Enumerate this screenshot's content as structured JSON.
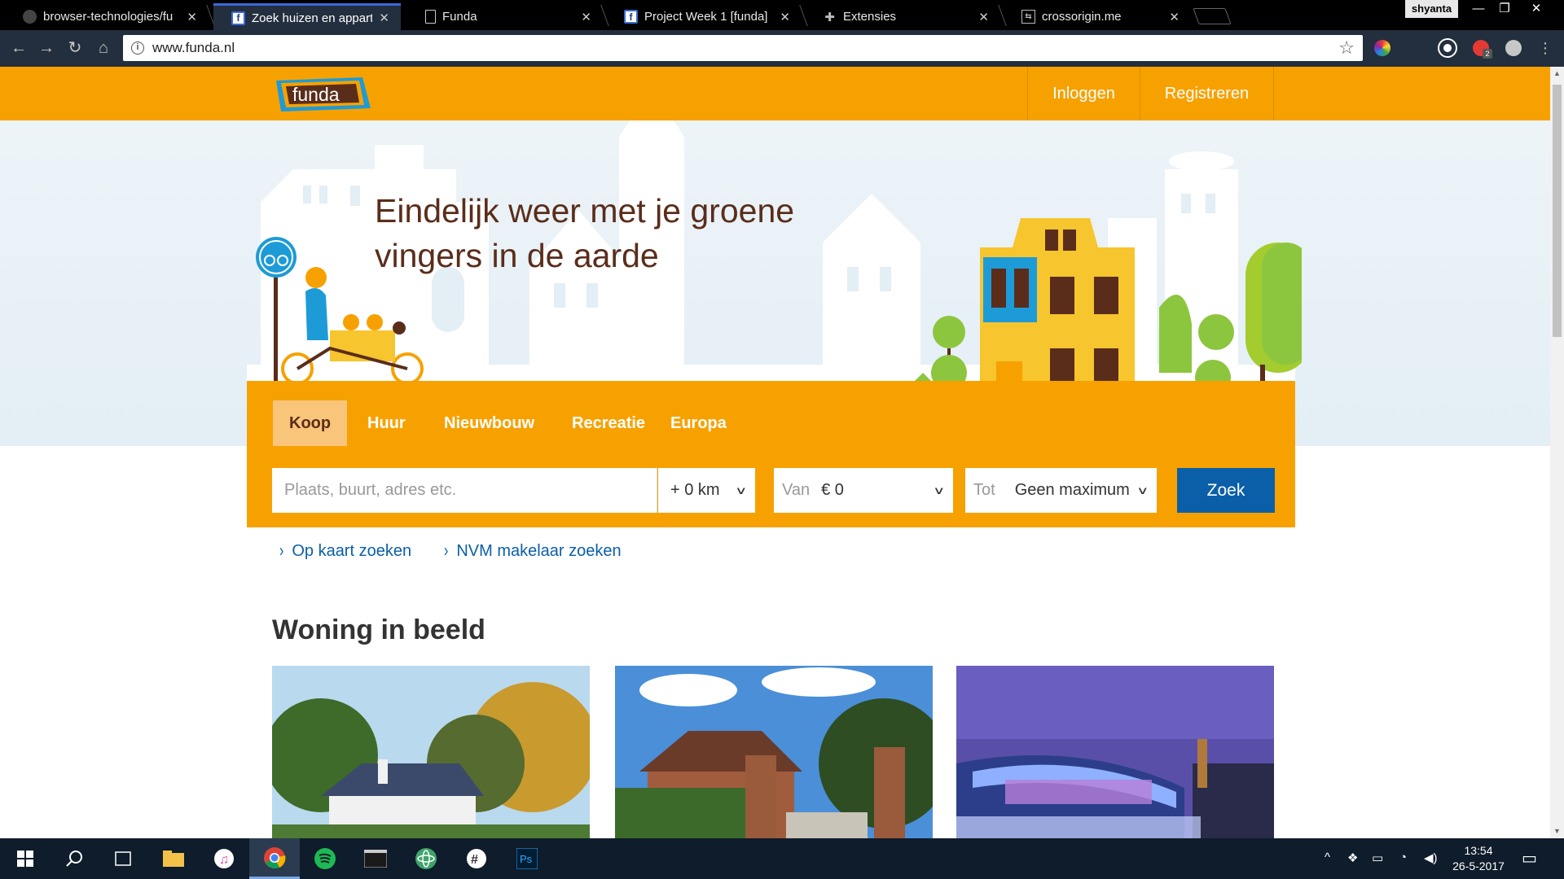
{
  "browser": {
    "tabs": [
      {
        "label": "browser-technologies/fu",
        "favicon": "github-icon",
        "active": false
      },
      {
        "label": "Zoek huizen en apparten",
        "favicon": "funda-icon",
        "active": true
      },
      {
        "label": "Funda",
        "favicon": "document-icon",
        "active": false
      },
      {
        "label": "Project Week 1 [funda]",
        "favicon": "funda-icon",
        "active": false
      },
      {
        "label": "Extensies",
        "favicon": "puzzle-icon",
        "active": false
      },
      {
        "label": "crossorigin.me",
        "favicon": "arrows-icon",
        "active": false
      }
    ],
    "profile_name": "shyanta",
    "url": "www.funda.nl",
    "extension_badge": "2"
  },
  "header": {
    "logo_text": "funda",
    "login_label": "Inloggen",
    "register_label": "Registreren"
  },
  "hero": {
    "title": "Eindelijk weer met je groene vingers in de aarde"
  },
  "search": {
    "tabs": [
      "Koop",
      "Huur",
      "Nieuwbouw",
      "Recreatie",
      "Europa"
    ],
    "active_tab": "Koop",
    "location_placeholder": "Plaats, buurt, adres etc.",
    "radius_value": "+ 0 km",
    "price_from_label": "Van",
    "price_from_value": "€ 0",
    "price_to_label": "Tot",
    "price_to_value": "Geen maximum",
    "submit_label": "Zoek"
  },
  "quicklinks": [
    "Op kaart zoeken",
    "NVM makelaar zoeken"
  ],
  "featured": {
    "title": "Woning in beeld"
  },
  "taskbar": {
    "time": "13:54",
    "date": "26-5-2017"
  },
  "colors": {
    "funda_orange": "#f7a100",
    "funda_blue": "#0b5fa8",
    "heading_brown": "#5a2d1b"
  }
}
